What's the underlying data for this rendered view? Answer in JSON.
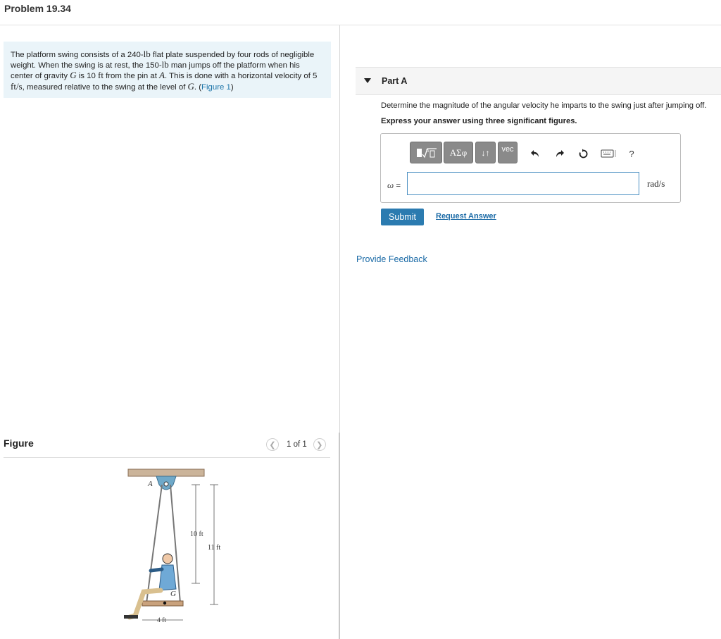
{
  "page": {
    "title": "Problem 19.34"
  },
  "problem": {
    "part1": "The platform swing consists of a 240-",
    "unit_lb_1": "lb",
    "part2": " flat plate suspended by four rods of negligible weight. When the swing is at rest, the 150-",
    "unit_lb_2": "lb",
    "part3": " man jumps off the platform when his center of gravity ",
    "var_G_1": "G",
    "part4": " is 10 ",
    "unit_ft": "ft",
    "part5": " from the pin at ",
    "var_A": "A",
    "part6": ". This is done with a horizontal velocity of 5 ",
    "unit_fts": "ft/s",
    "part7": ", measured relative to the swing at the level of ",
    "var_G_2": "G",
    "part8": ". (",
    "figure_link": "Figure 1",
    "part9": ")"
  },
  "figure": {
    "label": "Figure",
    "pager": {
      "count": "1 of 1",
      "prev_icon": "chevron-left-icon",
      "next_icon": "chevron-right-icon"
    },
    "labels": {
      "A": "A",
      "G": "G",
      "dim_10": "10 ft",
      "dim_11": "11 ft",
      "dim_4": "4 ft"
    }
  },
  "part_a": {
    "label": "Part A",
    "question": "Determine the magnitude of the angular velocity he imparts to the swing just after jumping off.",
    "instruction": "Express your answer using three significant figures.",
    "toolbar": {
      "greek_label": "ΑΣφ",
      "arrows_label": "↓↑",
      "vec_label": "vec",
      "help_label": "?"
    },
    "variable": "ω",
    "equals": " =",
    "answer_value": "",
    "unit": "rad/s",
    "submit_label": "Submit",
    "request_label": "Request Answer"
  },
  "feedback_label": "Provide Feedback",
  "colors": {
    "accent": "#2b7bb0",
    "link": "#1a73a8",
    "problem_bg": "#eaf4f9"
  }
}
